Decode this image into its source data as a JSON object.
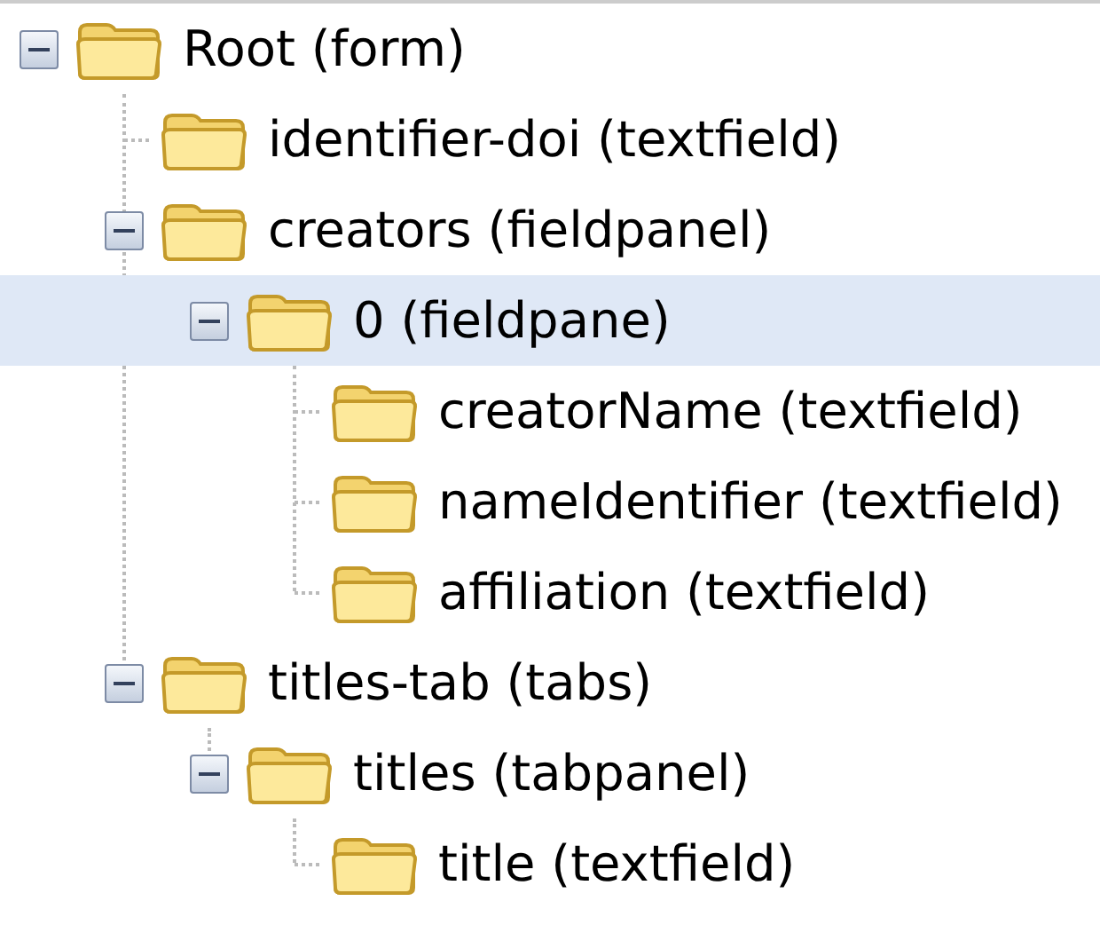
{
  "tree": [
    {
      "label": "Root (form)",
      "expanded": true,
      "selected": false,
      "children": [
        {
          "label": "identifier-doi (textfield)",
          "selected": false
        },
        {
          "label": "creators (fieldpanel)",
          "expanded": true,
          "selected": false,
          "children": [
            {
              "label": "0 (fieldpane)",
              "expanded": true,
              "selected": true,
              "children": [
                {
                  "label": "creatorName (textfield)",
                  "selected": false
                },
                {
                  "label": "nameIdentifier (textfield)",
                  "selected": false
                },
                {
                  "label": "affiliation (textfield)",
                  "selected": false
                }
              ]
            }
          ]
        },
        {
          "label": "titles-tab (tabs)",
          "expanded": true,
          "selected": false,
          "children": [
            {
              "label": "titles (tabpanel)",
              "expanded": true,
              "selected": false,
              "children": [
                {
                  "label": "title (textfield)",
                  "selected": false
                }
              ]
            }
          ]
        }
      ]
    }
  ]
}
